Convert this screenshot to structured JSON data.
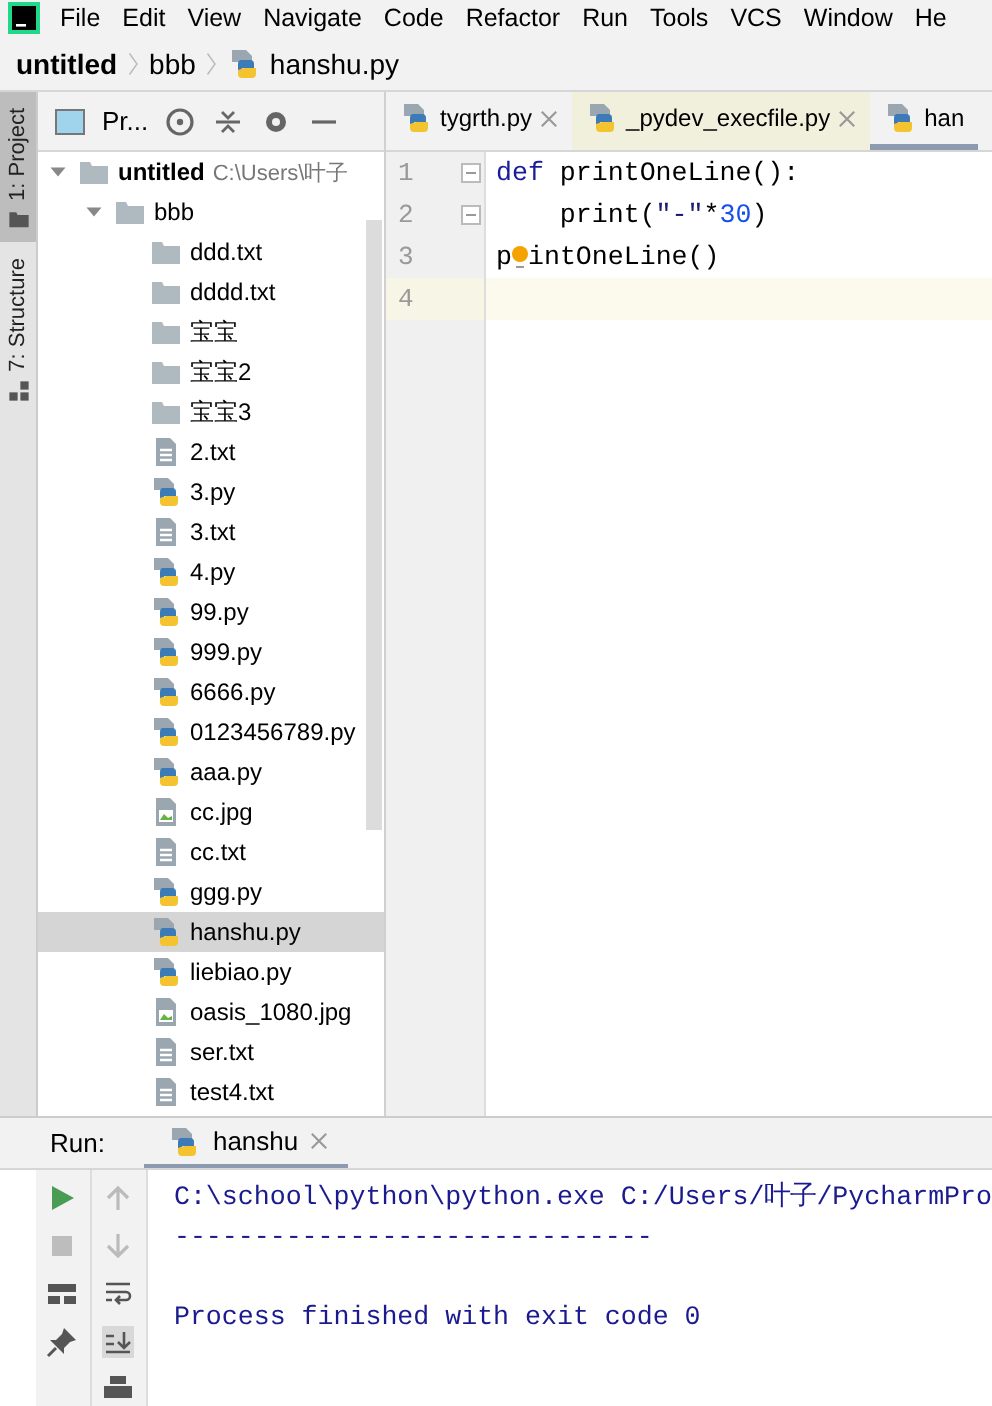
{
  "menu_bar": {
    "items": [
      "File",
      "Edit",
      "View",
      "Navigate",
      "Code",
      "Refactor",
      "Run",
      "Tools",
      "VCS",
      "Window",
      "He"
    ]
  },
  "breadcrumb": [
    {
      "label": "untitled",
      "kind": "root"
    },
    {
      "label": "bbb",
      "kind": "folder"
    },
    {
      "label": "hanshu.py",
      "kind": "py"
    }
  ],
  "tool_strip": [
    {
      "label": "1: Project",
      "selected": true,
      "kind": "project"
    },
    {
      "label": "7: Structure",
      "selected": false,
      "kind": "structure"
    }
  ],
  "project_panel": {
    "title": "Pr...",
    "tree": [
      {
        "label": "untitled",
        "path": "C:\\Users\\叶子",
        "kind": "root",
        "expanded": true,
        "selected": false,
        "children": [
          {
            "label": "bbb",
            "kind": "folder",
            "expanded": true,
            "selected": false,
            "children": [
              {
                "label": "ddd.txt",
                "kind": "folder",
                "selected": false
              },
              {
                "label": "dddd.txt",
                "kind": "folder",
                "selected": false
              },
              {
                "label": "宝宝",
                "kind": "folder",
                "selected": false
              },
              {
                "label": "宝宝2",
                "kind": "folder",
                "selected": false
              },
              {
                "label": "宝宝3",
                "kind": "folder",
                "selected": false
              },
              {
                "label": "2.txt",
                "kind": "txt",
                "selected": false
              },
              {
                "label": "3.py",
                "kind": "py",
                "selected": false
              },
              {
                "label": "3.txt",
                "kind": "txt",
                "selected": false
              },
              {
                "label": "4.py",
                "kind": "py",
                "selected": false
              },
              {
                "label": "99.py",
                "kind": "py",
                "selected": false
              },
              {
                "label": "999.py",
                "kind": "py",
                "selected": false
              },
              {
                "label": "6666.py",
                "kind": "py",
                "selected": false
              },
              {
                "label": "0123456789.py",
                "kind": "py",
                "selected": false
              },
              {
                "label": "aaa.py",
                "kind": "py",
                "selected": false
              },
              {
                "label": "cc.jpg",
                "kind": "jpg",
                "selected": false
              },
              {
                "label": "cc.txt",
                "kind": "txt",
                "selected": false
              },
              {
                "label": "ggg.py",
                "kind": "py",
                "selected": false
              },
              {
                "label": "hanshu.py",
                "kind": "py",
                "selected": true
              },
              {
                "label": "liebiao.py",
                "kind": "py",
                "selected": false
              },
              {
                "label": "oasis_1080.jpg",
                "kind": "jpg",
                "selected": false
              },
              {
                "label": "ser.txt",
                "kind": "txt",
                "selected": false
              },
              {
                "label": "test4.txt",
                "kind": "txt",
                "selected": false
              }
            ]
          }
        ]
      }
    ]
  },
  "editor_tabs": [
    {
      "label": "tygrth.py",
      "selected": false,
      "closable": true,
      "tinted": false
    },
    {
      "label": "_pydev_execfile.py",
      "selected": false,
      "closable": true,
      "tinted": true
    },
    {
      "label": "han",
      "selected": true,
      "closable": false,
      "tinted": false
    }
  ],
  "code_lines": [
    {
      "number": "1",
      "current": false,
      "fold": true,
      "tokens": [
        {
          "text": "def",
          "kind": "keyword"
        },
        {
          "text": " printOneLine():",
          "kind": "plain"
        }
      ]
    },
    {
      "number": "2",
      "current": false,
      "fold": true,
      "tokens": [
        {
          "text": "    print(",
          "kind": "plain"
        },
        {
          "text": "\"-\"",
          "kind": "string"
        },
        {
          "text": "*",
          "kind": "plain"
        },
        {
          "text": "30",
          "kind": "number"
        },
        {
          "text": ")",
          "kind": "plain"
        }
      ]
    },
    {
      "number": "3",
      "current": false,
      "fold": false,
      "tokens": [
        {
          "text": "p",
          "kind": "plain"
        },
        {
          "kind": "bulb"
        },
        {
          "text": "intOneLine()",
          "kind": "plain"
        }
      ]
    },
    {
      "number": "4",
      "current": true,
      "fold": false
    }
  ],
  "run_panel": {
    "label": "Run:",
    "tab": "hanshu",
    "output": [
      {
        "kind": "text",
        "text": "C:\\school\\python\\python.exe C:/Users/叶子/PycharmPro"
      },
      {
        "kind": "text",
        "text": "------------------------------"
      },
      {
        "kind": "blank"
      },
      {
        "kind": "text",
        "text": "Process finished with exit code 0"
      }
    ]
  }
}
